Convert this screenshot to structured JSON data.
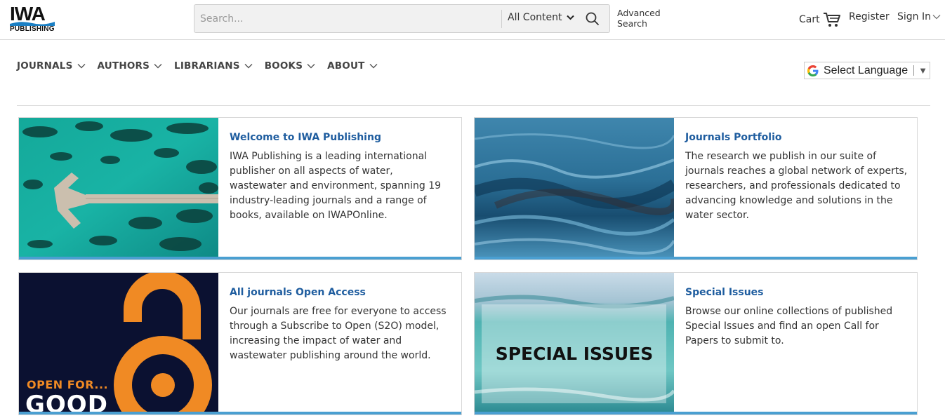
{
  "header": {
    "logo_text": "IWA",
    "logo_subtext": "PUBLISHING",
    "search_placeholder": "Search...",
    "search_scope": "All Content",
    "advanced_search": "Advanced Search",
    "cart_label": "Cart",
    "register_label": "Register",
    "signin_label": "Sign In"
  },
  "nav": {
    "items": [
      {
        "label": "JOURNALS"
      },
      {
        "label": "AUTHORS"
      },
      {
        "label": "LIBRARIANS"
      },
      {
        "label": "BOOKS"
      },
      {
        "label": "ABOUT"
      }
    ]
  },
  "language": {
    "label": "Select Language"
  },
  "cards": [
    {
      "title": "Welcome to IWA Publishing",
      "text": "IWA Publishing is a leading international publisher on all aspects of water, wastewater and environment, spanning 19 industry-leading journals and a range of books, available on IWAPOnline."
    },
    {
      "title": "Journals Portfolio",
      "text": "The research we publish in our suite of journals reaches a global network of experts, researchers, and professionals dedicated to advancing knowledge and solutions in the water sector."
    },
    {
      "title": "All journals Open Access",
      "text": "Our journals are free for everyone to access through a Subscribe to Open (S2O) model, increasing the impact of water and wastewater publishing around the world.",
      "image_text_1": "OPEN FOR...",
      "image_text_2": "GOOD"
    },
    {
      "title": "Special Issues",
      "text": "Browse our online collections of published Special Issues and find an open Call for Papers to submit to.",
      "image_text": "SPECIAL ISSUES"
    }
  ],
  "colors": {
    "link_blue": "#1f5d9f",
    "accent_bar": "#4a9fd1",
    "oa_orange": "#f08a24",
    "oa_navy": "#0b1131"
  }
}
